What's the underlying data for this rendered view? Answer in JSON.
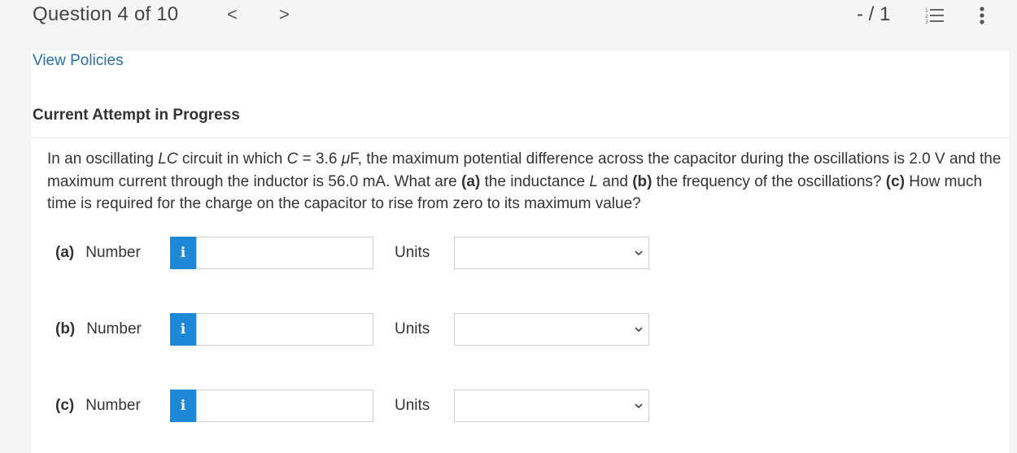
{
  "header": {
    "question_label": "Question 4 of 10",
    "prev_symbol": "<",
    "next_symbol": ">",
    "score": "- / 1"
  },
  "policies_link": "View Policies",
  "attempt_heading": "Current Attempt in Progress",
  "question_parts": [
    {
      "text": "In an oscillating ",
      "style": "normal"
    },
    {
      "text": "LC",
      "style": "italic"
    },
    {
      "text": " circuit in which ",
      "style": "normal"
    },
    {
      "text": "C",
      "style": "italic"
    },
    {
      "text": " = 3.6 ",
      "style": "normal"
    },
    {
      "text": "μ",
      "style": "italic"
    },
    {
      "text": "F, the maximum potential difference across the capacitor during the oscillations is 2.0 V and the maximum current through the inductor is 56.0 mA. What are ",
      "style": "normal"
    },
    {
      "text": "(a)",
      "style": "bold"
    },
    {
      "text": " the inductance ",
      "style": "normal"
    },
    {
      "text": "L",
      "style": "italic"
    },
    {
      "text": " and ",
      "style": "normal"
    },
    {
      "text": "(b)",
      "style": "bold"
    },
    {
      "text": " the frequency of the oscillations? ",
      "style": "normal"
    },
    {
      "text": "(c)",
      "style": "bold"
    },
    {
      "text": " How much time is required for the charge on the capacitor to rise from zero to its maximum value?",
      "style": "normal"
    }
  ],
  "answers": {
    "a": {
      "part": "(a)",
      "label": "Number",
      "info": "i",
      "value": "",
      "units_label": "Units",
      "units_value": ""
    },
    "b": {
      "part": "(b)",
      "label": "Number",
      "info": "i",
      "value": "",
      "units_label": "Units",
      "units_value": ""
    },
    "c": {
      "part": "(c)",
      "label": "Number",
      "info": "i",
      "value": "",
      "units_label": "Units",
      "units_value": ""
    }
  },
  "colors": {
    "accent": "#1e88d6",
    "link": "#2a6fa8"
  }
}
